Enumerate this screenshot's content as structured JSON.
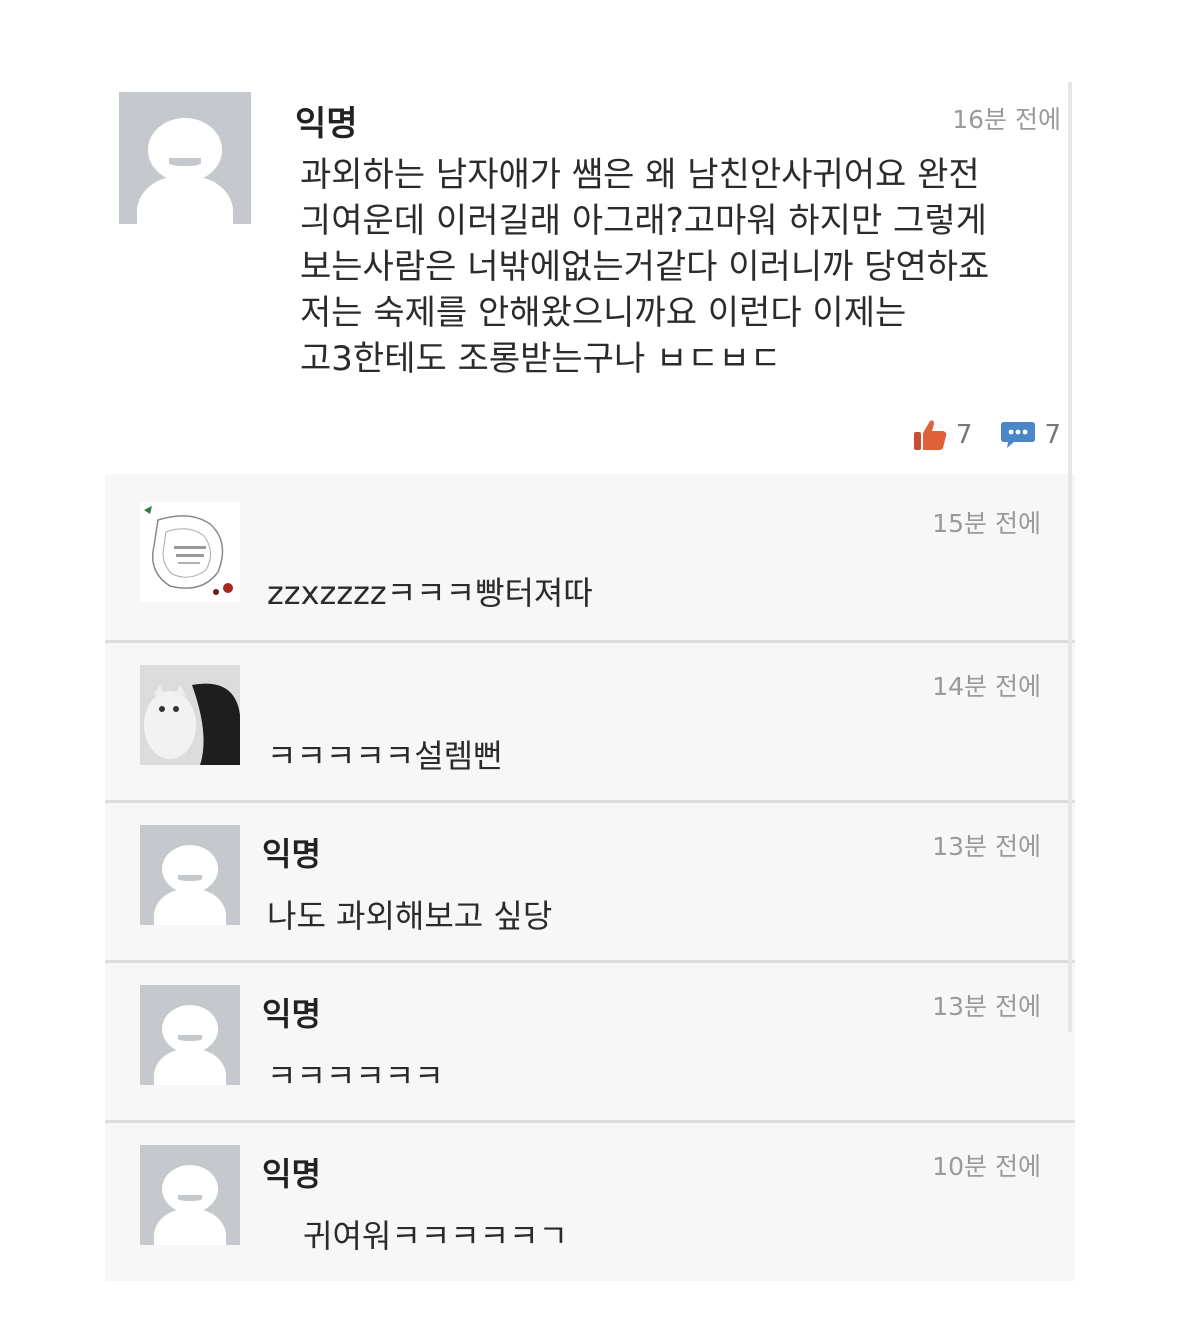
{
  "post": {
    "author": "익명",
    "time": "16분 전에",
    "body_lines": [
      "과외하는 남자애가 쌤은 왜 남친안사귀어요 완전",
      "긔여운데 이러길래 아그래?고마워 하지만 그렇게",
      "보는사람은 너밖에없는거같다 이러니까 당연하죠",
      "저는 숙제를 안해왔으니까요 이런다 이제는",
      "고3한테도 조롱받는구나 ㅂㄷㅂㄷ"
    ],
    "likes": "7",
    "comments": "7",
    "icons": {
      "like": "thumbs-up-icon",
      "comment": "speech-bubble-icon"
    }
  },
  "comments": [
    {
      "author": "",
      "time": "15분 전에",
      "text": "zzxzzzzㅋㅋㅋ빵터져따",
      "avatar": "book-cover-image"
    },
    {
      "author": "",
      "time": "14분 전에",
      "text": "ㅋㅋㅋㅋㅋ설렘뻔",
      "avatar": "cat-photo-image"
    },
    {
      "author": "익명",
      "time": "13분 전에",
      "text": "나도 과외해보고 싶당",
      "avatar": "default-avatar"
    },
    {
      "author": "익명",
      "time": "13분 전에",
      "text": "ㅋㅋㅋㅋㅋㅋ",
      "avatar": "default-avatar"
    },
    {
      "author": "익명",
      "time": "10분 전에",
      "text": "귀여워ㅋㅋㅋㅋㅋㄱ",
      "avatar": "default-avatar"
    }
  ],
  "colors": {
    "avatar_gray": "#c5c8cc",
    "like": "#e0603a",
    "comment": "#4a86c8",
    "time": "#9a9a9a"
  }
}
